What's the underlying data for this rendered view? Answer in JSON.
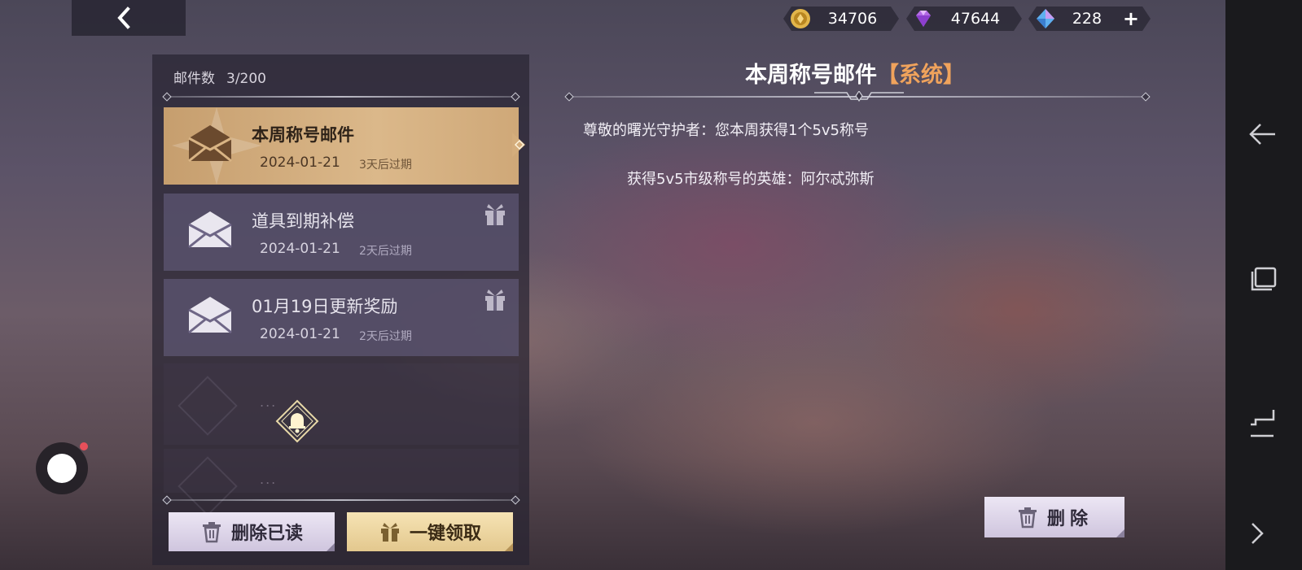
{
  "top_bar": {
    "back_icon": "chevron-left-icon",
    "currencies": [
      {
        "name": "gold-coin",
        "value": "34706",
        "color": "#e2b54a"
      },
      {
        "name": "purple-diamond",
        "value": "47644",
        "color": "#b46ae6"
      },
      {
        "name": "blue-crystal",
        "value": "228",
        "color": "#5fb0f0",
        "add_label": "+"
      }
    ]
  },
  "mail_list": {
    "count_label": "邮件数",
    "count_value": "3/200",
    "items": [
      {
        "title": "本周称号邮件",
        "date": "2024-01-21",
        "expiry": "3天后过期",
        "selected": true,
        "has_gift": false
      },
      {
        "title": "道具到期补偿",
        "date": "2024-01-21",
        "expiry": "2天后过期",
        "selected": false,
        "has_gift": true
      },
      {
        "title": "01月19日更新奖励",
        "date": "2024-01-21",
        "expiry": "2天后过期",
        "selected": false,
        "has_gift": true
      }
    ],
    "placeholder_dots": "...",
    "delete_read_label": "删除已读",
    "claim_all_label": "一键领取"
  },
  "mail_detail": {
    "title": "本周称号邮件",
    "tag": "【系统】",
    "line1": "尊敬的曙光守护者：您本周获得1个5v5称号",
    "line2": "获得5v5市级称号的英雄：阿尔忒弥斯",
    "delete_label": "删除"
  },
  "accent_colors": {
    "selected_item": "#d4ad7c",
    "tag_orange": "#f0a35c",
    "button_light": "#e2dbeb",
    "button_gold": "#eed6a0"
  }
}
